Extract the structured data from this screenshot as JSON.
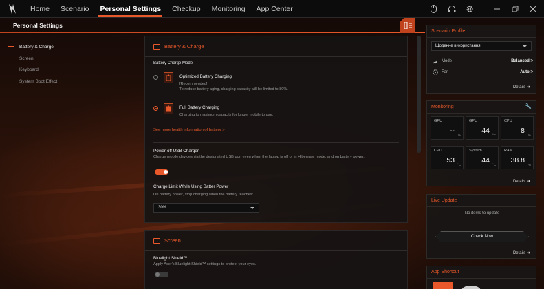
{
  "nav": {
    "tabs": [
      "Home",
      "Scenario",
      "Personal Settings",
      "Checkup",
      "Monitoring",
      "App Center"
    ],
    "active_tab": "Personal Settings"
  },
  "page": {
    "title": "Personal Settings"
  },
  "sidebar": {
    "items": [
      {
        "label": "Battery & Charge",
        "active": true
      },
      {
        "label": "Screen",
        "active": false
      },
      {
        "label": "Keyboard",
        "active": false
      },
      {
        "label": "System Boot Effect",
        "active": false
      }
    ]
  },
  "battery": {
    "section_title": "Battery & Charge",
    "mode_label": "Battery Charge Mode",
    "options": [
      {
        "title": "Optimized Battery Charging",
        "sub1": "[Recommended]",
        "sub2": "To reduce battery aging, charging capacity will be limited to 80%.",
        "selected": false
      },
      {
        "title": "Full Battery Charging",
        "sub1": "Charging to maximum capacity for longer mobile to use.",
        "sub2": "",
        "selected": true
      }
    ],
    "health_link": "See more health information of battery >",
    "usb_title": "Power-off USB Charger",
    "usb_desc": "Charge mobile devices via the designated USB port even when the laptop is off or in Hibernate mode, and on battery power.",
    "usb_enabled": true,
    "limit_title": "Charge Limit While Using Batter Power",
    "limit_desc": "On battery power, stop charging when the battery reaches:",
    "limit_value": "30%"
  },
  "screen": {
    "section_title": "Screen",
    "bluelight_title": "Bluelight Shield™",
    "bluelight_desc": "Apply Acer's Bluelight Shield™ settings to protect your eyes.",
    "bluelight_enabled": false
  },
  "scenario_profile": {
    "title": "Scenario Profile",
    "selected": "Щоденне використання",
    "mode_label": "Mode",
    "mode_value": "Balanced >",
    "fan_label": "Fan",
    "fan_value": "Auto >",
    "details": "Details"
  },
  "monitoring": {
    "title": "Monitoring",
    "cells": [
      {
        "label": "GPU",
        "value": "--",
        "unit": "%"
      },
      {
        "label": "GPU",
        "value": "44",
        "unit": "°C"
      },
      {
        "label": "CPU",
        "value": "8",
        "unit": "%"
      },
      {
        "label": "CPU",
        "value": "53",
        "unit": "°C"
      },
      {
        "label": "System",
        "value": "44",
        "unit": "°C"
      },
      {
        "label": "RAM",
        "value": "38.8",
        "unit": "%"
      }
    ],
    "details": "Details"
  },
  "live_update": {
    "title": "Live Update",
    "status": "No items to update",
    "button": "Check Now",
    "details": "Details"
  },
  "app_shortcut": {
    "title": "App Shortcut"
  },
  "colors": {
    "accent": "#e8582a"
  }
}
